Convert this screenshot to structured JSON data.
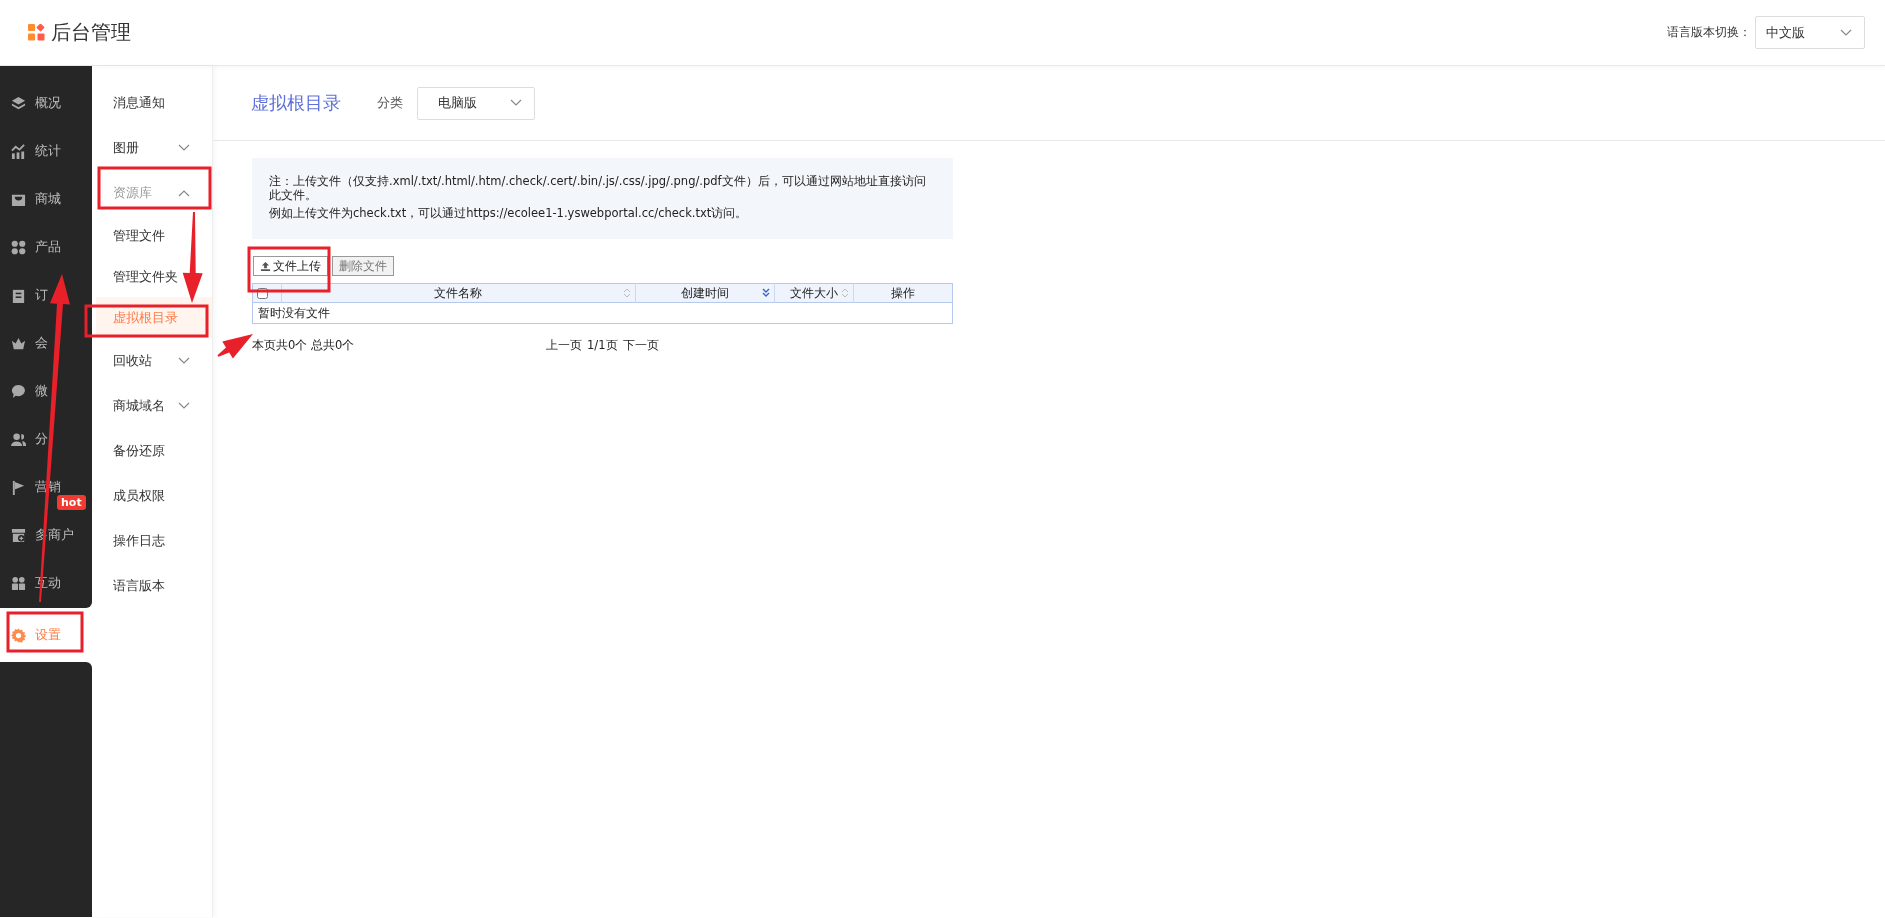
{
  "header": {
    "logo_text": "后台管理",
    "language_label": "语言版本切换：",
    "language_select": "中文版"
  },
  "nav": [
    {
      "label": "概况",
      "selected": false
    },
    {
      "label": "统计",
      "selected": false
    },
    {
      "label": "商城",
      "selected": false
    },
    {
      "label": "产品",
      "selected": false
    },
    {
      "label": "订",
      "selected": false
    },
    {
      "label": "会",
      "selected": false
    },
    {
      "label": "微",
      "selected": false
    },
    {
      "label": "分",
      "selected": false
    },
    {
      "label": "营销",
      "selected": false,
      "badge": "hot"
    },
    {
      "label": "多商户",
      "selected": false
    },
    {
      "label": "互动",
      "selected": false
    },
    {
      "label": "设置",
      "selected": true
    }
  ],
  "subnav": [
    {
      "label": "消息通知",
      "selected": false
    },
    {
      "label": "图册",
      "selected": false,
      "expanded": false
    },
    {
      "label": "资源库",
      "selected": false,
      "expanded": true,
      "children": [
        {
          "label": "管理文件",
          "selected": false
        },
        {
          "label": "管理文件夹",
          "selected": false
        },
        {
          "label": "虚拟根目录",
          "selected": true
        }
      ]
    },
    {
      "label": "回收站",
      "selected": false,
      "expanded": false
    },
    {
      "label": "商城域名",
      "selected": false,
      "expanded": false
    },
    {
      "label": "备份还原",
      "selected": false
    },
    {
      "label": "成员权限",
      "selected": false
    },
    {
      "label": "操作日志",
      "selected": false
    },
    {
      "label": "语言版本",
      "selected": false
    }
  ],
  "page": {
    "title": "虚拟根目录",
    "category_label": "分类",
    "category_select": "电脑版"
  },
  "note": [
    "注：上传文件（仅支持.xml/.txt/.html/.htm/.check/.cert/.bin/.js/.css/.jpg/.png/.pdf文件）后，可以通过网站地址直接访问此文件。",
    "例如上传文件为check.txt，可以通过https://ecolee1-1.yswebportal.cc/check.txt访问。"
  ],
  "buttons": [
    "文件上传",
    "删除文件"
  ],
  "table": {
    "select_all_checked": false,
    "columns": [
      {
        "label": "文件名称",
        "sorted": false
      },
      {
        "label": "创建时间",
        "sorted": true
      },
      {
        "label": "文件大小",
        "sorted": false
      },
      {
        "label": "操作"
      }
    ],
    "empty_text": "暂时没有文件"
  },
  "footer": {
    "summary": "本页共0个 总共0个",
    "prev": "上一页",
    "page_info": "1/1页",
    "next": "下一页"
  }
}
